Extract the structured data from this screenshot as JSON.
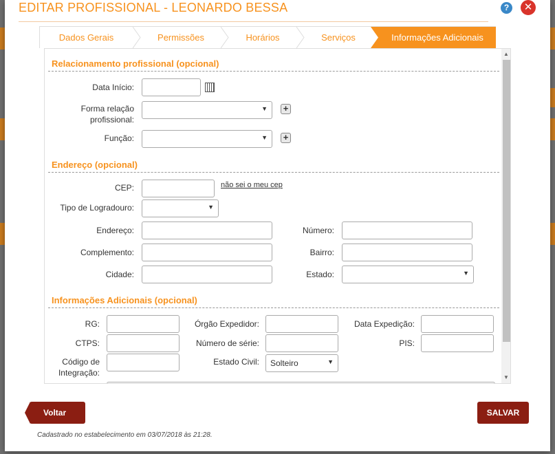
{
  "dialog": {
    "title": "EDITAR PROFISSIONAL - LEONARDO BESSA",
    "help_icon": "?",
    "close_icon": "✕"
  },
  "tabs": [
    {
      "label": "Dados Gerais"
    },
    {
      "label": "Permissões"
    },
    {
      "label": "Horários"
    },
    {
      "label": "Serviços"
    },
    {
      "label": "Informações Adicionais"
    }
  ],
  "relacionamento": {
    "title": "Relacionamento profissional (opcional)",
    "data_inicio_label": "Data Início:",
    "data_inicio_value": "",
    "forma_relacao_label": "Forma relação profissional:",
    "forma_relacao_value": "",
    "funcao_label": "Função:",
    "funcao_value": ""
  },
  "endereco": {
    "title": "Endereço (opcional)",
    "cep_label": "CEP:",
    "cep_value": "",
    "cep_link": "não sei o meu cep",
    "tipo_logradouro_label": "Tipo de Logradouro:",
    "tipo_logradouro_value": "",
    "endereco_label": "Endereço:",
    "numero_label": "Número:",
    "complemento_label": "Complemento:",
    "bairro_label": "Bairro:",
    "cidade_label": "Cidade:",
    "estado_label": "Estado:",
    "estado_value": ""
  },
  "info_adicionais": {
    "title": "Informações Adicionais (opcional)",
    "rg_label": "RG:",
    "orgao_label": "Órgão Expedidor:",
    "data_exp_label": "Data Expedição:",
    "ctps_label": "CTPS:",
    "num_serie_label": "Número de série:",
    "pis_label": "PIS:",
    "codigo_label": "Código de Integração:",
    "estado_civil_label": "Estado Civil:",
    "estado_civil_value": "Solteiro"
  },
  "buttons": {
    "voltar": "Voltar",
    "salvar": "SALVAR"
  },
  "footer": "Cadastrado no estabelecimento em 03/07/2018 às 21:28."
}
